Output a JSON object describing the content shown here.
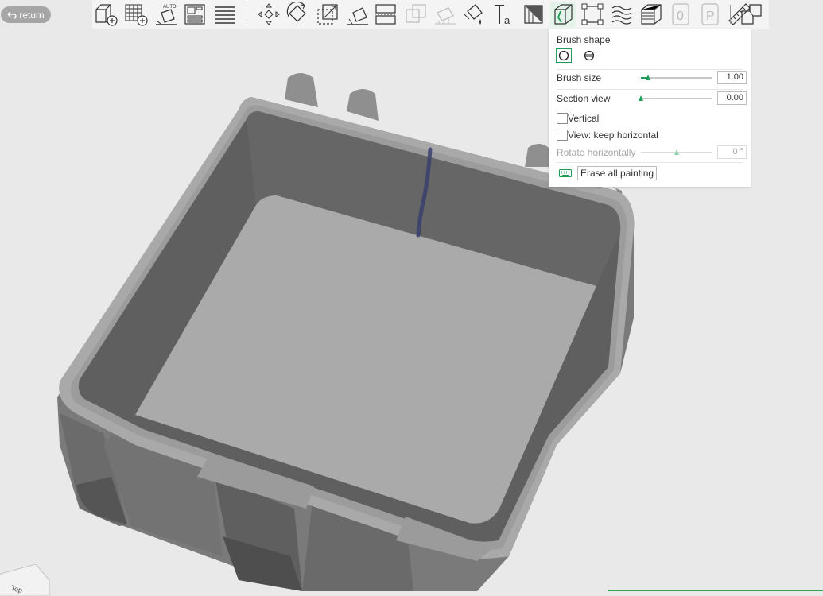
{
  "header": {
    "return_label": "return"
  },
  "toolbar": {
    "tools": [
      {
        "icon": "add-object-icon"
      },
      {
        "icon": "add-plate-icon"
      },
      {
        "icon": "auto-orient-icon",
        "text": "AUTO"
      },
      {
        "icon": "arrange-icon"
      },
      {
        "icon": "layers-icon"
      },
      {
        "icon": "move-icon"
      },
      {
        "icon": "rotate-icon"
      },
      {
        "icon": "scale-icon"
      },
      {
        "icon": "lay-on-face-icon"
      },
      {
        "icon": "cut-icon"
      },
      {
        "icon": "boolean-icon"
      },
      {
        "icon": "support-paint-icon"
      },
      {
        "icon": "color-paint-icon"
      },
      {
        "icon": "text-icon",
        "text": "Ta"
      },
      {
        "icon": "measure-icon"
      },
      {
        "icon": "seam-paint-icon"
      },
      {
        "icon": "fuzzy-skin-icon"
      },
      {
        "icon": "mesh-icon"
      },
      {
        "icon": "variable-layer-icon"
      },
      {
        "icon": "assembly-icon"
      },
      {
        "icon": "brim-ears-icon"
      },
      {
        "icon": "ruler-icon"
      },
      {
        "icon": "split-objects-icon"
      }
    ],
    "accent": "#1f9d55"
  },
  "panel": {
    "brush_shape_label": "Brush shape",
    "brush_size_label": "Brush size",
    "brush_size_value": "1.00",
    "brush_size_fraction": 0.1,
    "section_view_label": "Section view",
    "section_view_value": "0.00",
    "section_view_fraction": 0.0,
    "vertical_label": "Vertical",
    "keep_horizontal_label": "View: keep horizontal",
    "rotate_label": "Rotate horizontally",
    "rotate_value": "0 °",
    "rotate_fraction": 0.5,
    "erase_label": "Erase all painting"
  },
  "viewport": {
    "view_cube_label": "Top"
  }
}
